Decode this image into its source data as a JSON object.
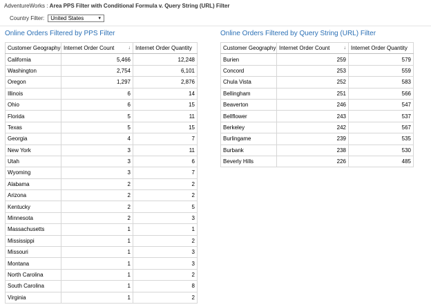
{
  "header": {
    "site": "AdventureWorks :",
    "title": "Area PPS Filter with Conditional Formula v. Query String (URL) Filter"
  },
  "filter": {
    "label": "Country Filter:",
    "selected": "United States"
  },
  "columns": {
    "geo": "Customer Geography",
    "count": "Internet Order Count",
    "quantity": "Internet Order Quantity"
  },
  "left_panel": {
    "title": "Online Orders Filtered by PPS Filter",
    "rows": [
      [
        "California",
        "5,466",
        "12,248"
      ],
      [
        "Washington",
        "2,754",
        "6,101"
      ],
      [
        "Oregon",
        "1,297",
        "2,876"
      ],
      [
        "Illinois",
        "6",
        "14"
      ],
      [
        "Ohio",
        "6",
        "15"
      ],
      [
        "Florida",
        "5",
        "11"
      ],
      [
        "Texas",
        "5",
        "15"
      ],
      [
        "Georgia",
        "4",
        "7"
      ],
      [
        "New York",
        "3",
        "11"
      ],
      [
        "Utah",
        "3",
        "6"
      ],
      [
        "Wyoming",
        "3",
        "7"
      ],
      [
        "Alabama",
        "2",
        "2"
      ],
      [
        "Arizona",
        "2",
        "2"
      ],
      [
        "Kentucky",
        "2",
        "5"
      ],
      [
        "Minnesota",
        "2",
        "3"
      ],
      [
        "Massachusetts",
        "1",
        "1"
      ],
      [
        "Mississippi",
        "1",
        "2"
      ],
      [
        "Missouri",
        "1",
        "3"
      ],
      [
        "Montana",
        "1",
        "3"
      ],
      [
        "North Carolina",
        "1",
        "2"
      ],
      [
        "South Carolina",
        "1",
        "8"
      ],
      [
        "Virginia",
        "1",
        "2"
      ]
    ]
  },
  "right_panel": {
    "title": "Online Orders Filtered by Query String (URL) Filter",
    "rows": [
      [
        "Burien",
        "259",
        "579"
      ],
      [
        "Concord",
        "253",
        "559"
      ],
      [
        "Chula Vista",
        "252",
        "583"
      ],
      [
        "Bellingham",
        "251",
        "566"
      ],
      [
        "Beaverton",
        "246",
        "547"
      ],
      [
        "Bellflower",
        "243",
        "537"
      ],
      [
        "Berkeley",
        "242",
        "567"
      ],
      [
        "Burlingame",
        "239",
        "535"
      ],
      [
        "Burbank",
        "238",
        "530"
      ],
      [
        "Beverly Hills",
        "226",
        "485"
      ]
    ]
  }
}
